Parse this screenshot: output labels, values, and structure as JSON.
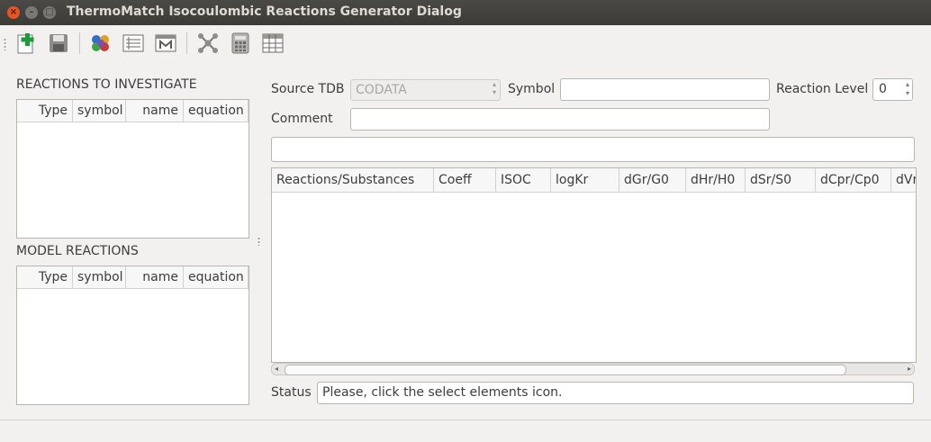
{
  "window": {
    "title": "ThermoMatch Isocoulombic Reactions Generator Dialog",
    "controls": {
      "close": "×",
      "minimize": "–",
      "maximize": "□"
    }
  },
  "toolbar": {
    "icons": [
      "new-icon",
      "save-icon",
      "select-elements-icon",
      "list-icon",
      "matrix-icon",
      "network-icon",
      "calculator-icon",
      "table-icon"
    ]
  },
  "left": {
    "investigate": {
      "title": "REACTIONS TO INVESTIGATE",
      "columns": [
        "Type",
        "symbol",
        "name",
        "equation"
      ]
    },
    "model": {
      "title": "MODEL REACTIONS",
      "columns": [
        "Type",
        "symbol",
        "name",
        "equation"
      ]
    }
  },
  "form": {
    "source_tdb_label": "Source TDB",
    "source_tdb_value": "CODATA",
    "symbol_label": "Symbol",
    "symbol_value": "",
    "reaction_level_label": "Reaction Level",
    "reaction_level_value": "0",
    "comment_label": "Comment",
    "comment_value": "",
    "formula_value": ""
  },
  "table": {
    "columns": [
      "Reactions/Substances",
      "Coeff",
      "ISOC",
      "logKr",
      "dGr/G0",
      "dHr/H0",
      "dSr/S0",
      "dCpr/Cp0",
      "dVr"
    ]
  },
  "status": {
    "label": "Status",
    "value": "Please, click the select elements icon."
  }
}
